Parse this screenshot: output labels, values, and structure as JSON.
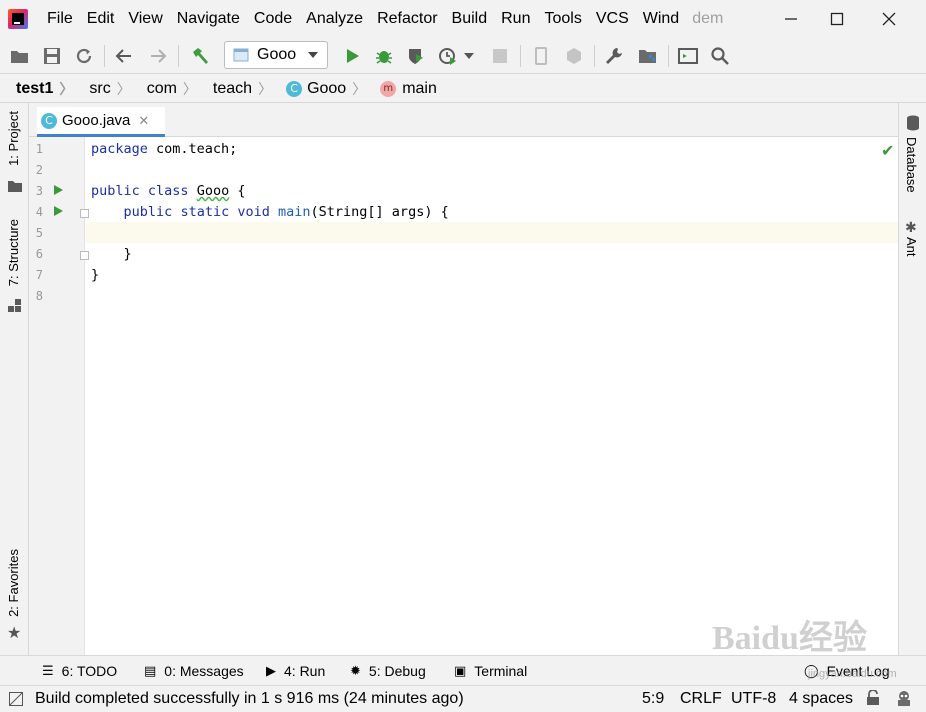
{
  "menu": {
    "file": "File",
    "edit": "Edit",
    "view": "View",
    "navigate": "Navigate",
    "code": "Code",
    "analyze": "Analyze",
    "refactor": "Refactor",
    "build": "Build",
    "run": "Run",
    "tools": "Tools",
    "vcs": "VCS",
    "window": "Wind",
    "project_cut": "dem"
  },
  "toolbar": {
    "run_config": "Gooo"
  },
  "breadcrumb": {
    "project": "test1",
    "src": "src",
    "com": "com",
    "teach": "teach",
    "class": "Gooo",
    "method": "main",
    "class_icon_letter": "C",
    "method_icon_letter": "m"
  },
  "tab": {
    "filename": "Gooo.java",
    "icon_letter": "C"
  },
  "left_tools": {
    "project": "1: Project",
    "structure": "7: Structure",
    "favorites": "2: Favorites"
  },
  "right_tools": {
    "database": "Database",
    "ant": "Ant"
  },
  "code": {
    "line_numbers": [
      "1",
      "2",
      "3",
      "4",
      "5",
      "6",
      "7",
      "8"
    ],
    "l1_kw": "package",
    "l1_rest": " com.teach;",
    "l3_kw1": "public",
    "l3_kw2": "class",
    "l3_name": "Gooo",
    "l3_rest": " {",
    "l4_kw1": "public",
    "l4_kw2": "static",
    "l4_kw3": "void",
    "l4_fn": "main",
    "l4_rest": "(String[] args) {",
    "l6": "    }",
    "l7": "}"
  },
  "tool_windows": {
    "todo": "6: TODO",
    "messages": "0: Messages",
    "run": "4: Run",
    "debug": "5: Debug",
    "terminal": "Terminal",
    "event_log": "Event Log"
  },
  "status": {
    "message": "Build completed successfully in 1 s 916 ms (24 minutes ago)",
    "position": "5:9",
    "line_sep": "CRLF",
    "encoding": "UTF-8",
    "indent": "4 spaces"
  },
  "watermark": {
    "text": "Baidu经验",
    "url": "jingyan.baidu.com"
  },
  "colors": {
    "accent": "#4083c9",
    "run_green": "#3a9a3a",
    "keyword": "#1c2fa5",
    "current_line": "#fcfaed"
  }
}
